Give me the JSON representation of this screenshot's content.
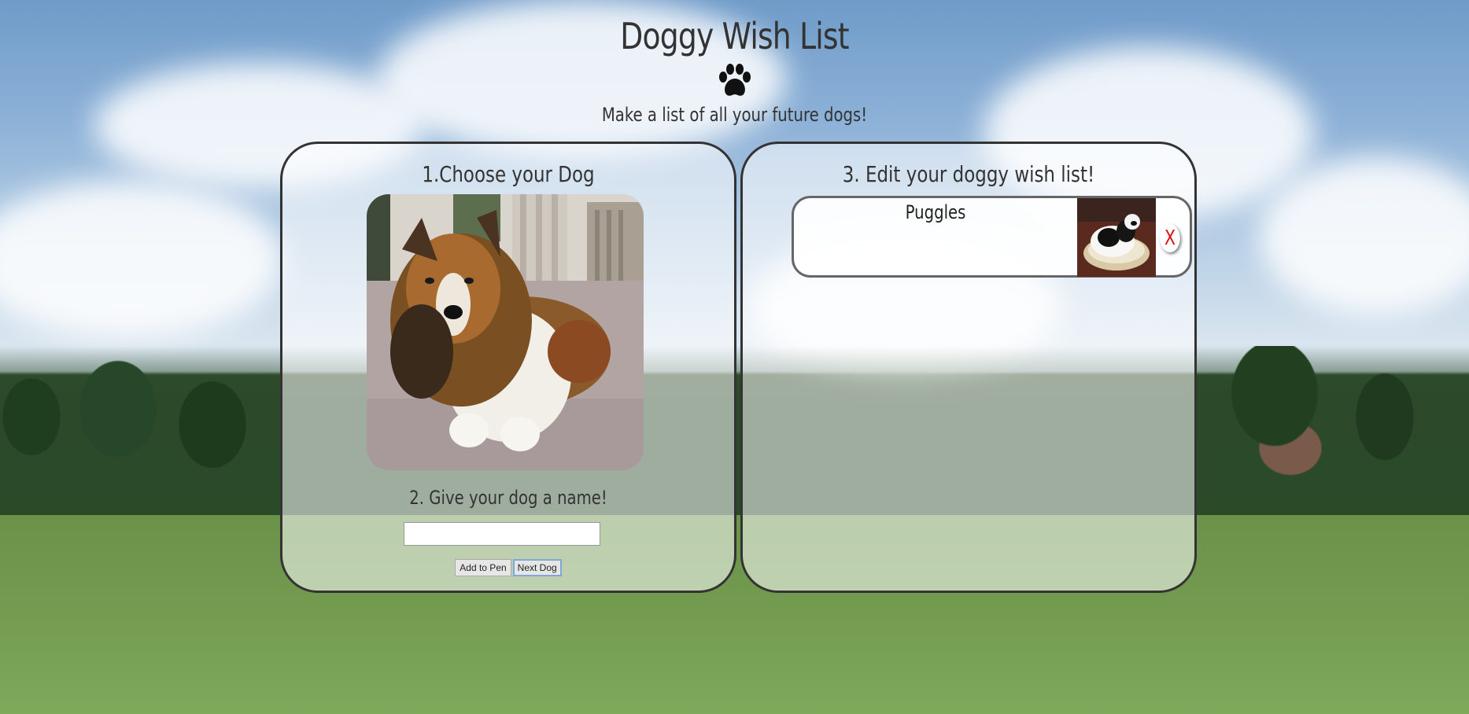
{
  "header": {
    "title": "Doggy Wish List",
    "paw_icon": "paw-icon",
    "subtitle": "Make a list of all your future dogs!"
  },
  "choose_panel": {
    "heading": "1.Choose your Dog",
    "dog_photo": "sheltie-photo",
    "name_label": "2. Give your dog a name!",
    "name_input_value": "",
    "add_button": "Add to Pen",
    "next_button": "Next Dog"
  },
  "wish_panel": {
    "heading": "3. Edit your doggy wish list!",
    "items": [
      {
        "name": "Puggles",
        "thumbnail": "pug-photo",
        "remove_label": "X"
      }
    ]
  },
  "colors": {
    "text": "#333333",
    "panel_border": "#333333",
    "remove_x": "#dd1111"
  }
}
